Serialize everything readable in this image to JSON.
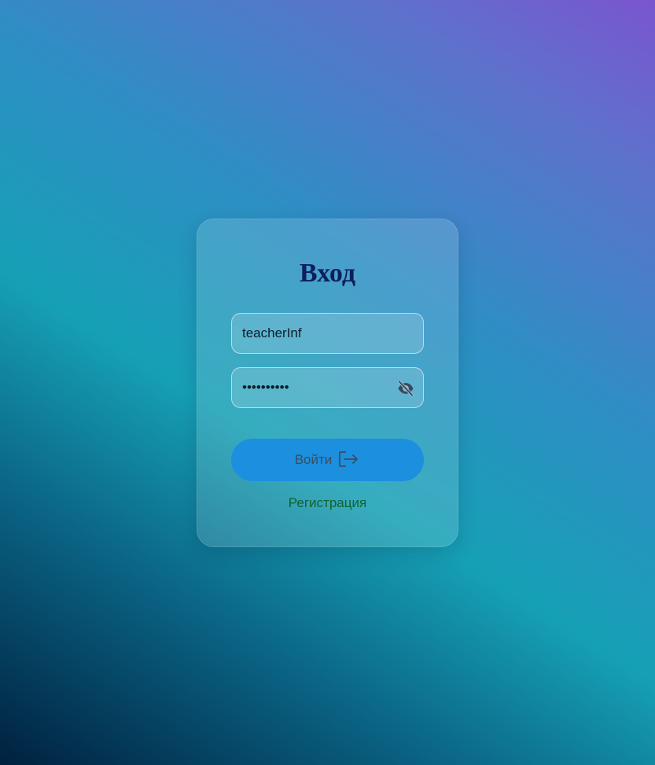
{
  "login_form": {
    "title": "Вход",
    "username_value": "teacherInf",
    "password_value": "••••••••••",
    "password_toggle_icon": "eye-slash-icon",
    "submit_label": "Войти",
    "submit_icon": "sign-in-icon",
    "register_link": "Регистрация"
  },
  "colors": {
    "title": "#0d1f5c",
    "submit_button": "#1c8fde",
    "register_link": "#11622f",
    "background_start": "#00213f",
    "background_end": "#7a55cf"
  }
}
